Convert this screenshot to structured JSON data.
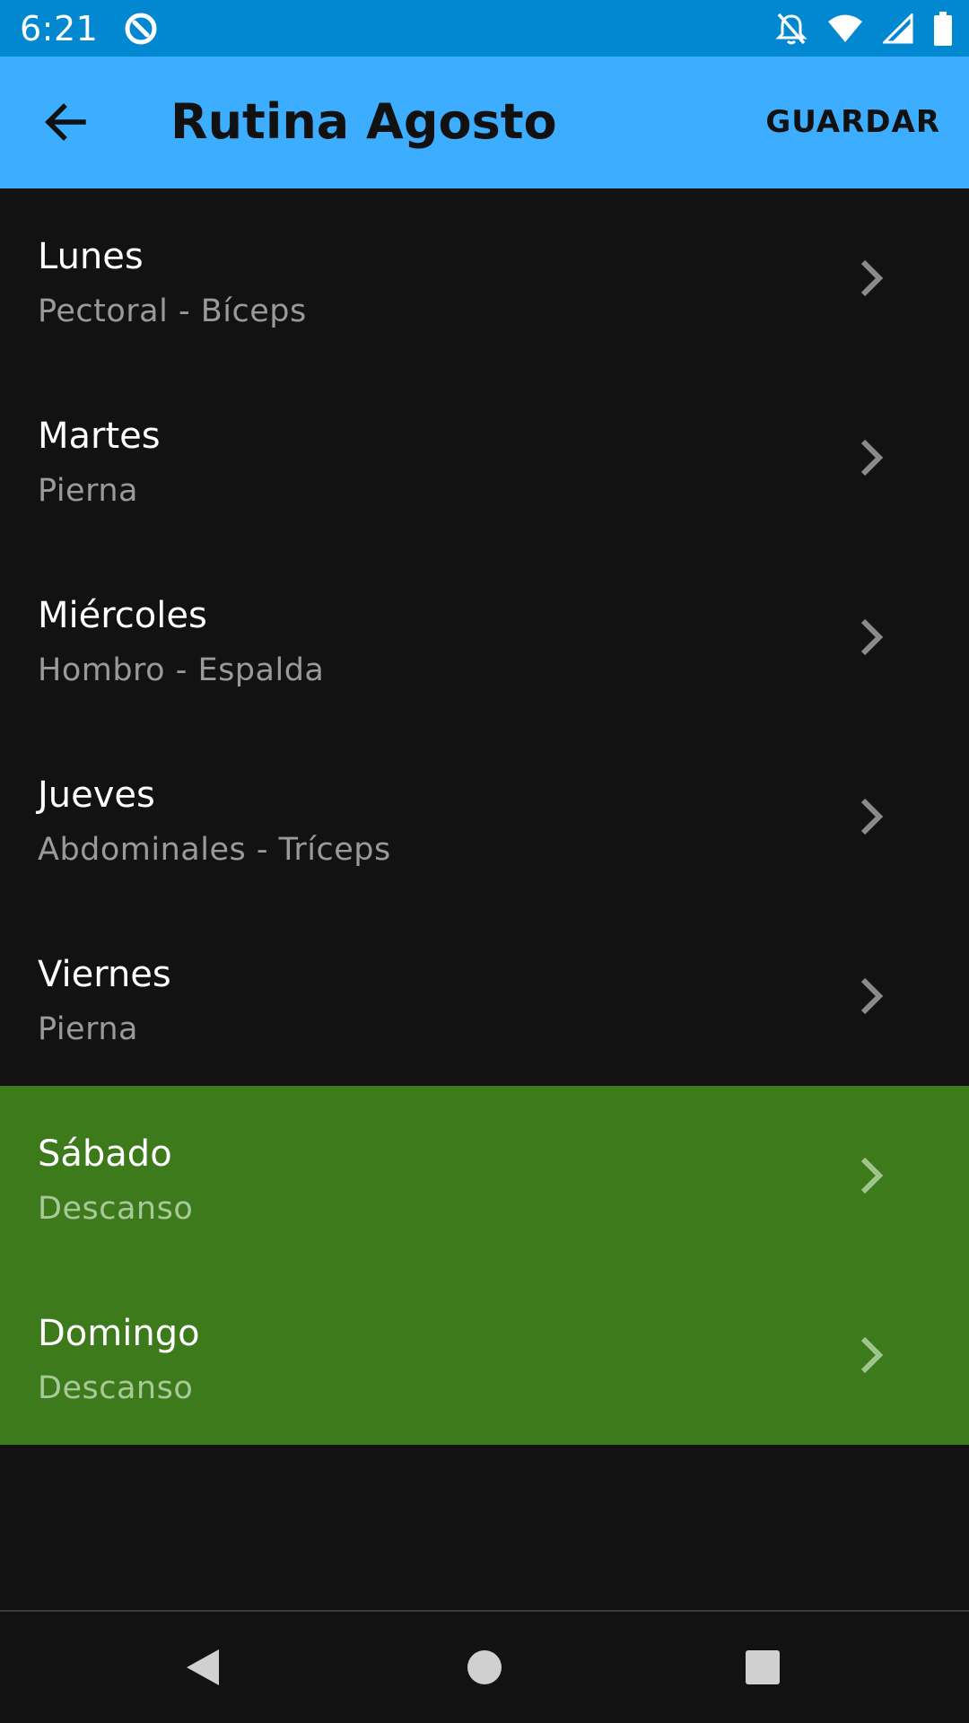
{
  "status_bar": {
    "time": "6:21",
    "icons": [
      "app-notification-icon",
      "notifications-off-icon",
      "wifi-icon",
      "signal-icon",
      "battery-icon"
    ]
  },
  "app_bar": {
    "back_icon": "arrow-back-icon",
    "title": "Rutina Agosto",
    "save_label": "GUARDAR",
    "background": "#3daeff"
  },
  "days": [
    {
      "name": "Lunes",
      "muscles": "Pectoral - Bíceps",
      "rest": false
    },
    {
      "name": "Martes",
      "muscles": "Pierna",
      "rest": false
    },
    {
      "name": "Miércoles",
      "muscles": "Hombro - Espalda",
      "rest": false
    },
    {
      "name": "Jueves",
      "muscles": "Abdominales - Tríceps",
      "rest": false
    },
    {
      "name": "Viernes",
      "muscles": "Pierna",
      "rest": false
    },
    {
      "name": "Sábado",
      "muscles": "Descanso",
      "rest": true
    },
    {
      "name": "Domingo",
      "muscles": "Descanso",
      "rest": true
    }
  ],
  "colors": {
    "status_bar": "#0288d1",
    "rest_day_background": "#3d7a1b",
    "list_background": "#121212"
  },
  "nav_bar": {
    "icons": [
      "back-triangle-icon",
      "home-circle-icon",
      "recents-square-icon"
    ]
  }
}
